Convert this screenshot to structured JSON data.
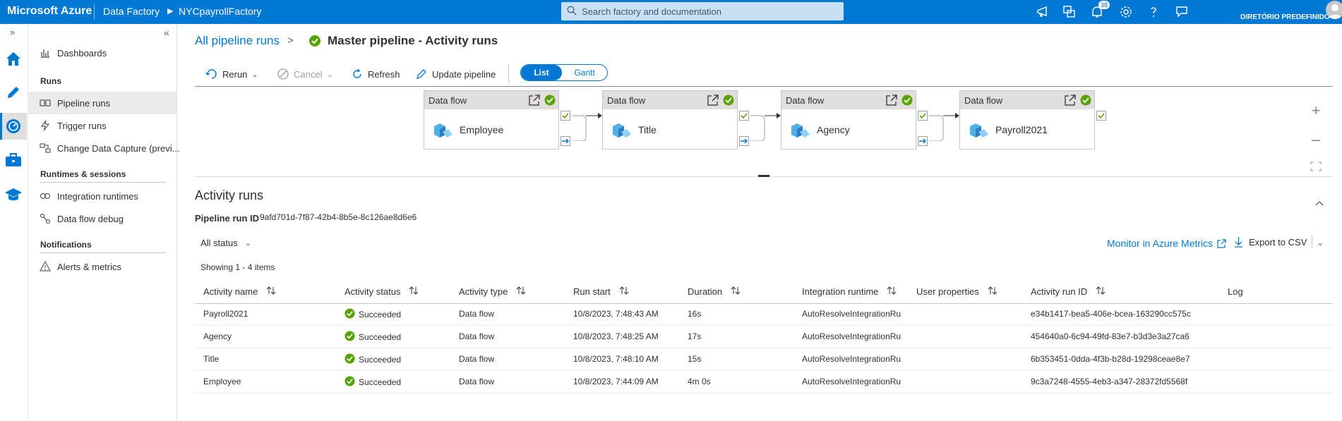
{
  "topbar": {
    "brand": "Microsoft Azure",
    "crumbs": [
      "Data Factory",
      "NYCpayrollFactory"
    ],
    "search_placeholder": "Search factory and documentation",
    "notification_count": "38",
    "directory": "DIRETÓRIO PREDEFINIDO",
    "icons": [
      "announcement-icon",
      "switch-directory-icon",
      "notifications-icon",
      "settings-icon",
      "help-icon",
      "feedback-icon",
      "avatar"
    ]
  },
  "rail": {
    "items": [
      "home-icon",
      "author-pencil-icon",
      "monitor-gauge-icon",
      "manage-toolbox-icon",
      "learning-center-icon"
    ],
    "active_index": 2
  },
  "sidenav": {
    "items": [
      {
        "label": "Dashboards",
        "icon": "dashboards-icon"
      },
      {
        "label": "Pipeline runs",
        "icon": "pipeline-runs-icon"
      },
      {
        "label": "Trigger runs",
        "icon": "trigger-runs-icon"
      },
      {
        "label": "Change Data Capture (previ...",
        "icon": "change-data-capture-icon"
      },
      {
        "label": "Integration runtimes",
        "icon": "integration-runtimes-icon"
      },
      {
        "label": "Data flow debug",
        "icon": "data-flow-debug-icon"
      },
      {
        "label": "Alerts & metrics",
        "icon": "alerts-icon"
      }
    ],
    "sections": [
      "Runs",
      "Runtimes & sessions",
      "Notifications"
    ],
    "active": "Pipeline runs"
  },
  "breadcrumb": {
    "link": "All pipeline runs",
    "separator": ">",
    "title": "Master pipeline - Activity runs"
  },
  "toolbar": {
    "rerun": "Rerun",
    "cancel": "Cancel",
    "refresh": "Refresh",
    "update": "Update pipeline",
    "view_list": "List",
    "view_gantt": "Gantt",
    "active_view": "List"
  },
  "pipeline_nodes": [
    {
      "type": "Data flow",
      "name": "Employee",
      "status": "succeeded"
    },
    {
      "type": "Data flow",
      "name": "Title",
      "status": "succeeded"
    },
    {
      "type": "Data flow",
      "name": "Agency",
      "status": "succeeded"
    },
    {
      "type": "Data flow",
      "name": "Payroll2021",
      "status": "succeeded"
    }
  ],
  "activity": {
    "title": "Activity runs",
    "pipeline_run_label": "Pipeline run ID",
    "pipeline_run_id": "9afd701d-7f87-42b4-8b5e-8c126ae8d6e6",
    "status_filter": "All status",
    "monitor_link": "Monitor in Azure Metrics",
    "export": "Export to CSV",
    "showing": "Showing 1 - 4 items",
    "columns": [
      "Activity name",
      "Activity status",
      "Activity type",
      "Run start",
      "Duration",
      "Integration runtime",
      "User properties",
      "Activity run ID",
      "Log"
    ],
    "rows": [
      {
        "name": "Payroll2021",
        "status": "Succeeded",
        "type": "Data flow",
        "run_start": "10/8/2023, 7:48:43 AM",
        "duration": "16s",
        "runtime": "AutoResolveIntegrationRu",
        "user_props": "",
        "run_id": "e34b1417-bea5-406e-bcea-163290cc575c"
      },
      {
        "name": "Agency",
        "status": "Succeeded",
        "type": "Data flow",
        "run_start": "10/8/2023, 7:48:25 AM",
        "duration": "17s",
        "runtime": "AutoResolveIntegrationRu",
        "user_props": "",
        "run_id": "454640a0-6c94-49fd-83e7-b3d3e3a27ca6"
      },
      {
        "name": "Title",
        "status": "Succeeded",
        "type": "Data flow",
        "run_start": "10/8/2023, 7:48:10 AM",
        "duration": "15s",
        "runtime": "AutoResolveIntegrationRu",
        "user_props": "",
        "run_id": "6b353451-0dda-4f3b-b28d-19298ceae8e7"
      },
      {
        "name": "Employee",
        "status": "Succeeded",
        "type": "Data flow",
        "run_start": "10/8/2023, 7:44:09 AM",
        "duration": "4m 0s",
        "runtime": "AutoResolveIntegrationRu",
        "user_props": "",
        "run_id": "9c3a7248-4555-4eb3-a347-28372fd5568f"
      }
    ]
  },
  "colors": {
    "accent": "#0078d4",
    "success": "#57a300",
    "topbar": "#0078d4"
  }
}
